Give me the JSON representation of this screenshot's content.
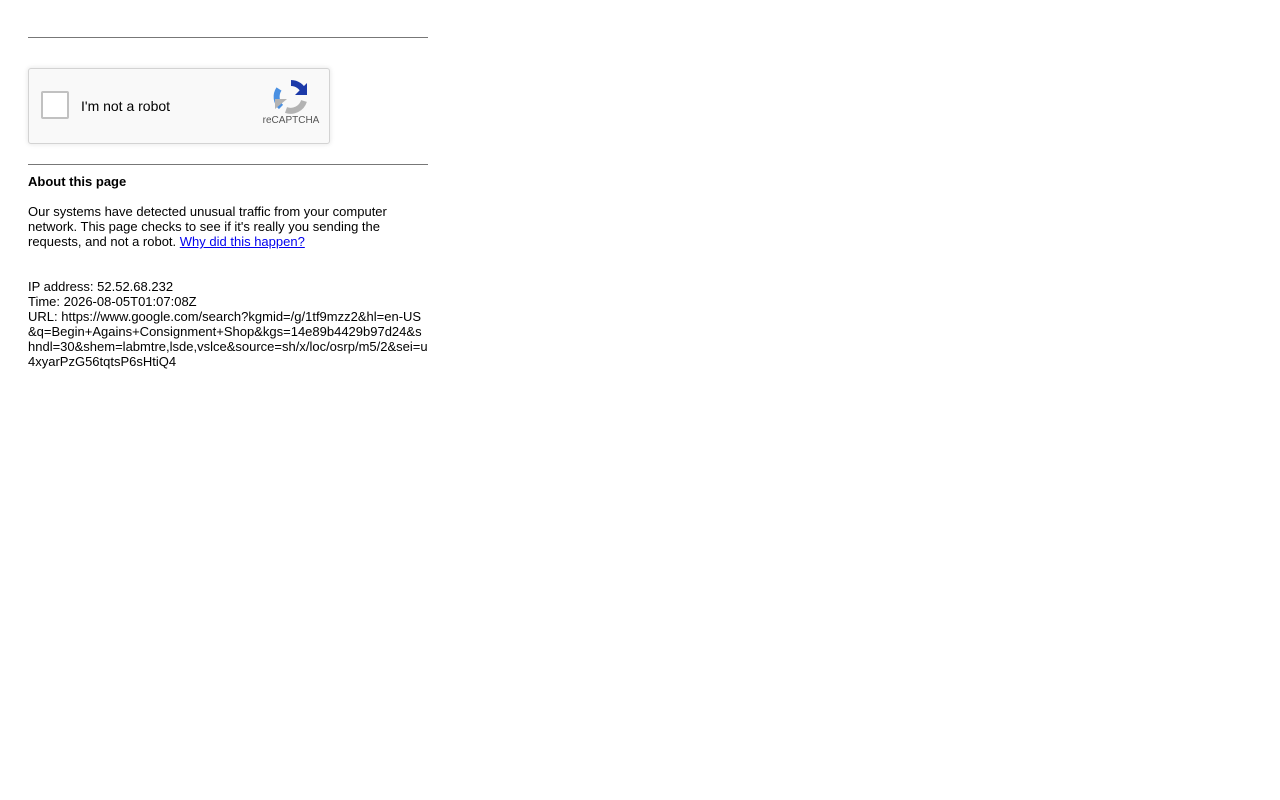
{
  "captcha": {
    "label": "I'm not a robot",
    "brand": "reCAPTCHA",
    "logo_icon": "recaptcha-logo-icon",
    "checked": false
  },
  "about": {
    "title": "About this page",
    "text": "Our systems have detected unusual traffic from your computer network. This page checks to see if it's really you sending the requests, and not a robot.",
    "link_label": "Why did this happen?"
  },
  "details": {
    "ip_prefix": "IP address: ",
    "ip": "52.52.68.232",
    "time_prefix": "Time: ",
    "time": "2026-08-05T01:07:08Z",
    "url_prefix": "URL: ",
    "url": "https://www.google.com/search?kgmid=/g/1tf9mzz2&hl=en-US&q=Begin+Agains+Consignment+Shop&kgs=14e89b4429b97d24&shndl=30&shem=labmtre,lsde,vslce&source=sh/x/loc/osrp/m5/2&sei=u4xyarPzG56tqtsP6sHtiQ4"
  },
  "colors": {
    "link": "#0000ee",
    "rule": "#777777",
    "captcha_bg": "#f9f9f9",
    "captcha_blue": "#1c3aa9",
    "captcha_lightblue": "#4a90e2",
    "captcha_gray": "#b3b3b3"
  }
}
